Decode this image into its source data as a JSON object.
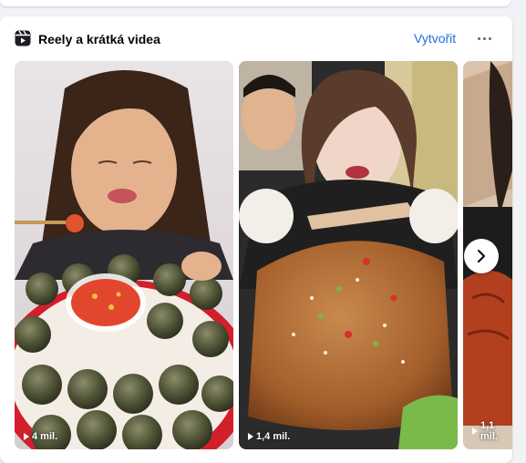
{
  "section": {
    "title": "Reely a krátká videa",
    "create_label": "Vytvořit",
    "more_icon": "ellipsis-icon",
    "section_icon": "reels-icon"
  },
  "reels": [
    {
      "views": "4 mil.",
      "description": "woman eating snails with dipping sauce"
    },
    {
      "views": "1,4 mil.",
      "description": "two people eating large roasted meat"
    },
    {
      "views": "1,1 mil.",
      "description": "person eating lobster"
    }
  ],
  "navigation": {
    "next_icon": "chevron-right-icon"
  },
  "colors": {
    "accent": "#216fdb",
    "title": "#050505",
    "icon": "#65676b",
    "background": "#f0f2f5"
  }
}
